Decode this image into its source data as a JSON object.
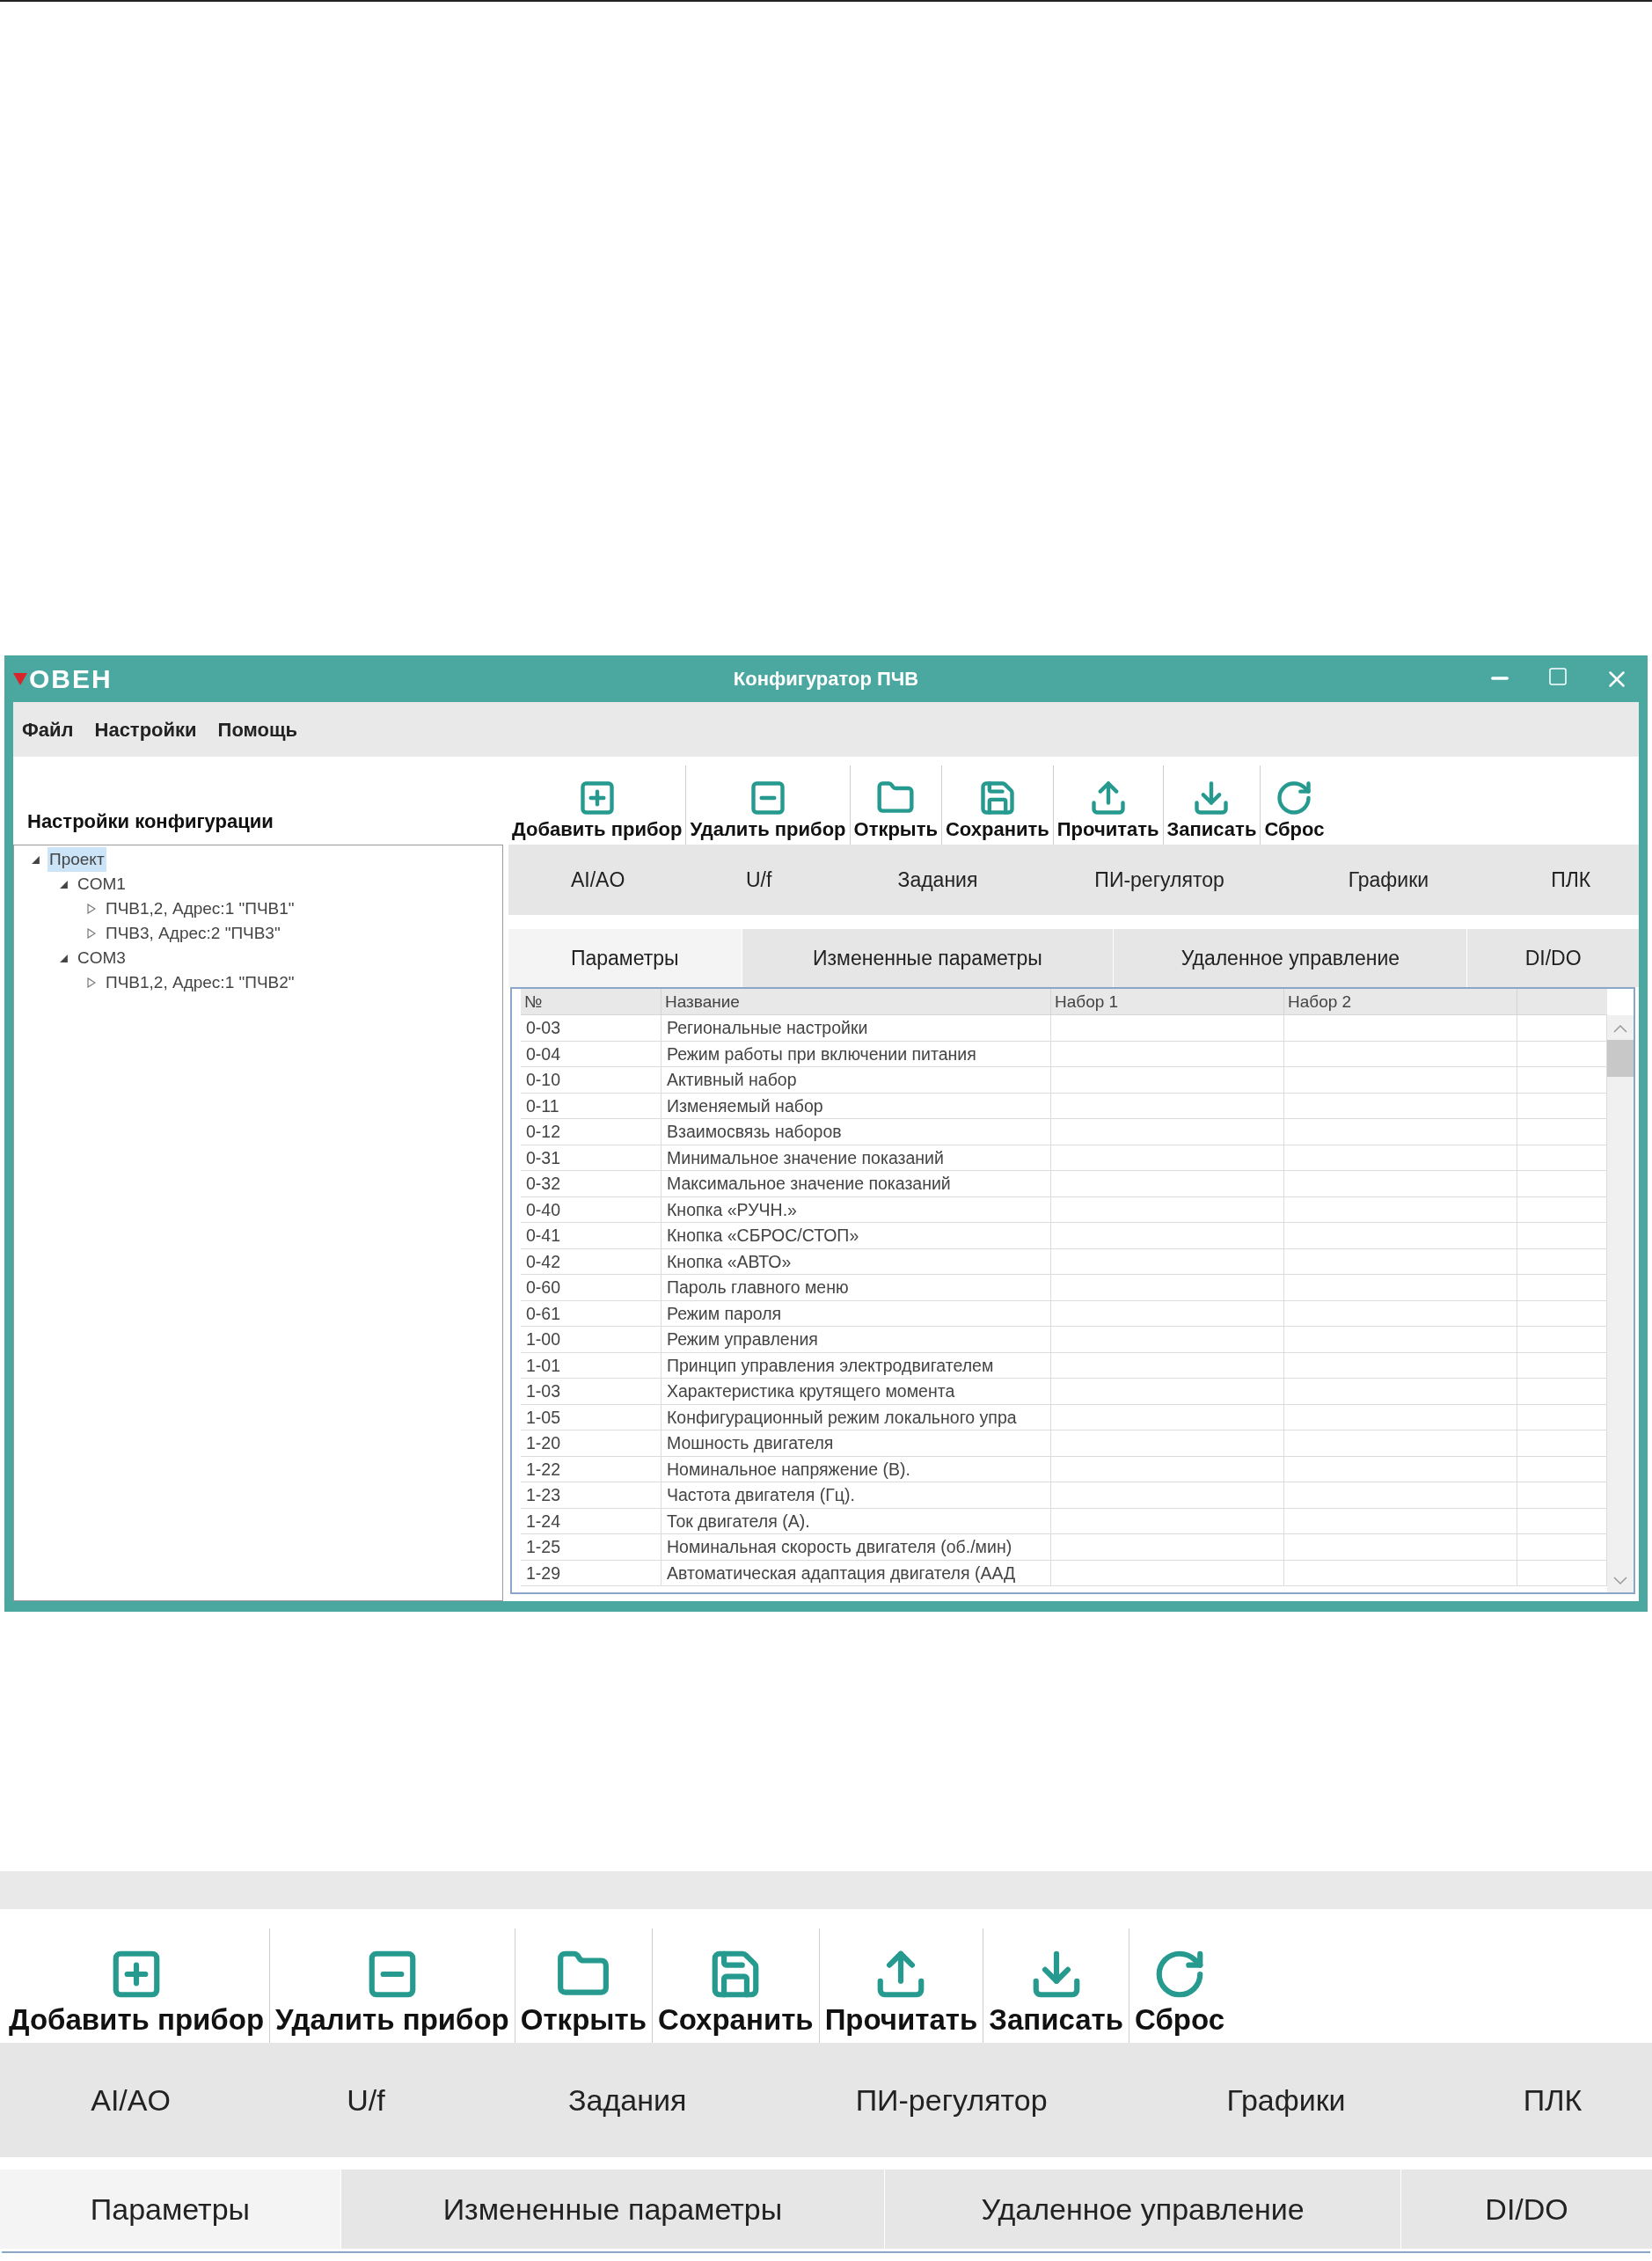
{
  "window": {
    "logo": "ОВЕН",
    "title": "Конфигуратор ПЧВ",
    "menu": [
      "Файл",
      "Настройки",
      "Помощь"
    ],
    "config_panel": {
      "title": "Настройки конфигурации",
      "tree": [
        {
          "label": "Проект",
          "expanded": true,
          "selected": true,
          "children": [
            {
              "label": "COM1",
              "expanded": true,
              "selected": false,
              "children": [
                {
                  "label": "ПЧВ1,2, Адрес:1 \"ПЧВ1\"",
                  "expanded": false,
                  "selected": false
                },
                {
                  "label": "ПЧВ3, Адрес:2 \"ПЧВ3\"",
                  "expanded": false,
                  "selected": false
                }
              ]
            },
            {
              "label": "COM3",
              "expanded": true,
              "selected": false,
              "children": [
                {
                  "label": "ПЧВ1,2, Адрес:1 \"ПЧВ2\"",
                  "expanded": false,
                  "selected": false
                }
              ]
            }
          ]
        }
      ]
    },
    "toolbar": [
      {
        "label": "Добавить прибор",
        "kind": "add"
      },
      {
        "label": "Удалить прибор",
        "kind": "remove"
      },
      {
        "label": "Открыть",
        "kind": "open"
      },
      {
        "label": "Сохранить",
        "kind": "save"
      },
      {
        "label": "Прочитать",
        "kind": "read"
      },
      {
        "label": "Записать",
        "kind": "write"
      },
      {
        "label": "Сброс",
        "kind": "reset"
      }
    ],
    "section_tabs": [
      {
        "label": "AI/AO"
      },
      {
        "label": "U/f"
      },
      {
        "label": "Задания"
      },
      {
        "label": "ПИ-регулятор"
      },
      {
        "label": "Графики"
      },
      {
        "label": "ПЛК"
      }
    ],
    "view_tabs": [
      {
        "label": "Параметры",
        "selected": true
      },
      {
        "label": "Измененные параметры",
        "selected": false
      },
      {
        "label": "Удаленное управление",
        "selected": false
      },
      {
        "label": "DI/DO",
        "selected": false
      }
    ],
    "table": {
      "columns": [
        "№",
        "Название",
        "Набор 1",
        "Набор 2"
      ],
      "rows": [
        [
          "0-03",
          "Региональные настройки"
        ],
        [
          "0-04",
          "Режим работы при включении питания"
        ],
        [
          "0-10",
          "Активный набор"
        ],
        [
          "0-11",
          "Изменяемый набор"
        ],
        [
          "0-12",
          "Взаимосвязь наборов"
        ],
        [
          "0-31",
          "Минимальное значение показаний"
        ],
        [
          "0-32",
          "Максимальное значение показаний"
        ],
        [
          "0-40",
          "Кнопка «РУЧН.»"
        ],
        [
          "0-41",
          "Кнопка «СБРОС/СТОП»"
        ],
        [
          "0-42",
          "Кнопка «АВТО»"
        ],
        [
          "0-60",
          "Пароль главного меню"
        ],
        [
          "0-61",
          "Режим пароля"
        ],
        [
          "1-00",
          "Режим управления"
        ],
        [
          "1-01",
          "Принцип управления электродвигателем"
        ],
        [
          "1-03",
          "Характеристика крутящего момента"
        ],
        [
          "1-05",
          "Конфигурационный режим локального упра"
        ],
        [
          "1-20",
          "Мошность двигателя"
        ],
        [
          "1-22",
          "Номинальное напряжение (В)."
        ],
        [
          "1-23",
          "Частота двигателя (Гц)."
        ],
        [
          "1-24",
          "Ток двигателя (А)."
        ],
        [
          "1-25",
          "Номинальная скорость двигателя (об./мин)"
        ],
        [
          "1-29",
          "Автоматическая адаптация двигателя (ААД"
        ]
      ]
    }
  },
  "zoomed_view": {
    "toolbar": [
      {
        "label": "Добавить прибор",
        "kind": "add"
      },
      {
        "label": "Удалить прибор",
        "kind": "remove"
      },
      {
        "label": "Открыть",
        "kind": "open"
      },
      {
        "label": "Сохранить",
        "kind": "save"
      },
      {
        "label": "Прочитать",
        "kind": "read"
      },
      {
        "label": "Записать",
        "kind": "write"
      },
      {
        "label": "Сброс",
        "kind": "reset"
      }
    ],
    "section_tabs": [
      {
        "label": "AI/AO"
      },
      {
        "label": "U/f"
      },
      {
        "label": "Задания"
      },
      {
        "label": "ПИ-регулятор"
      },
      {
        "label": "Графики"
      },
      {
        "label": "ПЛК"
      }
    ],
    "view_tabs": [
      {
        "label": "Параметры",
        "selected": true
      },
      {
        "label": "Измененные параметры",
        "selected": false
      },
      {
        "label": "Удаленное управление",
        "selected": false
      },
      {
        "label": "DI/DO",
        "selected": false
      }
    ]
  }
}
